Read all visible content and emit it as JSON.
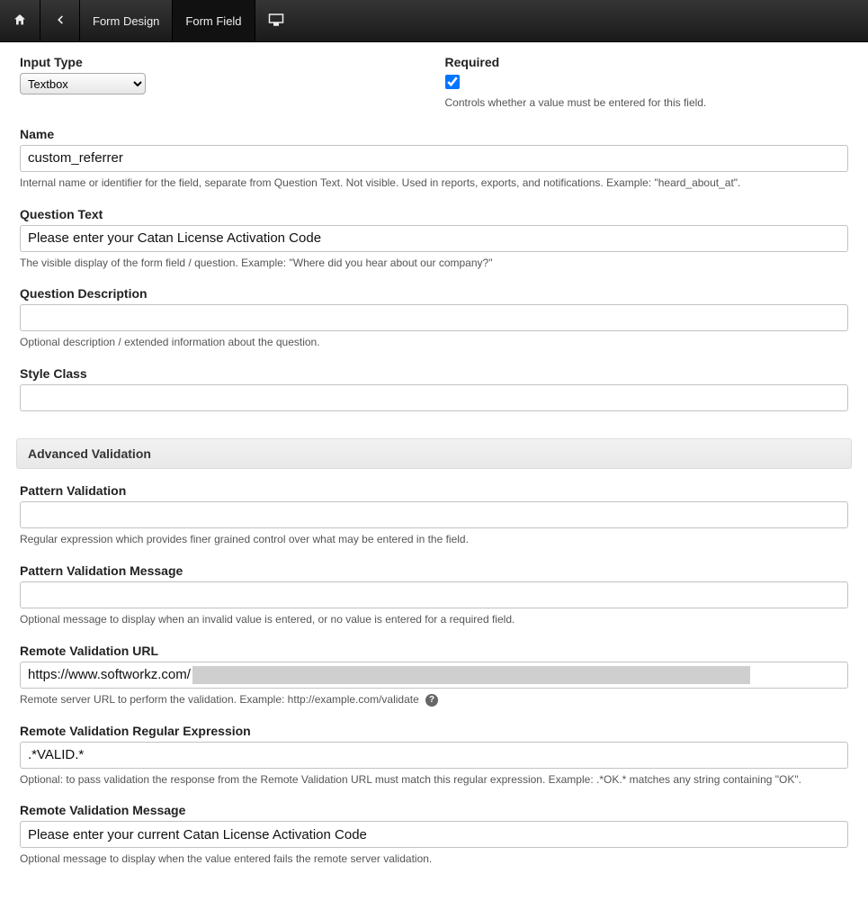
{
  "toolbar": {
    "tabs": [
      {
        "label": "Form Design"
      },
      {
        "label": "Form Field"
      }
    ]
  },
  "fields": {
    "inputType": {
      "label": "Input Type",
      "value": "Textbox"
    },
    "required": {
      "label": "Required",
      "checked": true,
      "help": "Controls whether a value must be entered for this field."
    },
    "name": {
      "label": "Name",
      "value": "custom_referrer",
      "help": "Internal name or identifier for the field, separate from Question Text. Not visible. Used in reports, exports, and notifications. Example: \"heard_about_at\"."
    },
    "questionText": {
      "label": "Question Text",
      "value": "Please enter your Catan License Activation Code",
      "help": "The visible display of the form field / question. Example: \"Where did you hear about our company?\""
    },
    "questionDescription": {
      "label": "Question Description",
      "value": "",
      "help": "Optional description / extended information about the question."
    },
    "styleClass": {
      "label": "Style Class",
      "value": ""
    }
  },
  "advanced": {
    "header": "Advanced Validation",
    "patternValidation": {
      "label": "Pattern Validation",
      "value": "",
      "help": "Regular expression which provides finer grained control over what may be entered in the field."
    },
    "patternValidationMessage": {
      "label": "Pattern Validation Message",
      "value": "",
      "help": "Optional message to display when an invalid value is entered, or no value is entered for a required field."
    },
    "remoteValidationURL": {
      "label": "Remote Validation URL",
      "prefix": "https://www.softworkz.com/",
      "help": "Remote server URL to perform the validation. Example: http://example.com/validate"
    },
    "remoteValidationRegex": {
      "label": "Remote Validation Regular Expression",
      "value": ".*VALID.*",
      "help": "Optional: to pass validation the response from the Remote Validation URL must match this regular expression. Example: .*OK.* matches any string containing \"OK\"."
    },
    "remoteValidationMessage": {
      "label": "Remote Validation Message",
      "value": "Please enter your current Catan License Activation Code",
      "help": "Optional message to display when the value entered fails the remote server validation."
    }
  }
}
